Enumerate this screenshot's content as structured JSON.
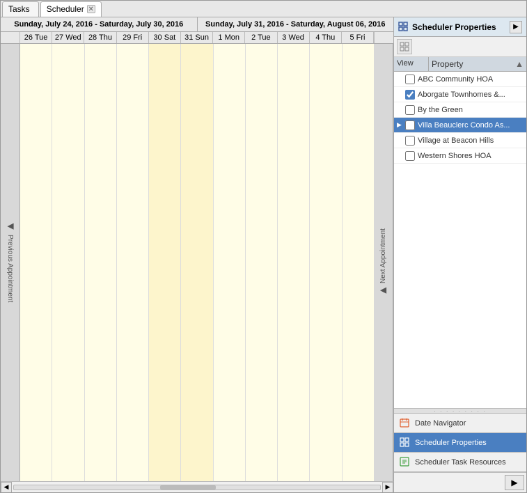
{
  "tabs": [
    {
      "id": "tasks",
      "label": "Tasks",
      "active": false,
      "closable": false
    },
    {
      "id": "scheduler",
      "label": "Scheduler",
      "active": true,
      "closable": true
    }
  ],
  "dateRanges": [
    {
      "label": "Sunday, July 24, 2016 - Saturday, July 30, 2016"
    },
    {
      "label": "Sunday, July 31, 2016 - Saturday, August 06, 2016"
    }
  ],
  "dayColumns": [
    {
      "label": "26 Tue",
      "weekend": false
    },
    {
      "label": "27 Wed",
      "weekend": false
    },
    {
      "label": "28 Thu",
      "weekend": false
    },
    {
      "label": "29 Fri",
      "weekend": false
    },
    {
      "label": "30 Sat",
      "weekend": true
    },
    {
      "label": "31 Sun",
      "weekend": true
    },
    {
      "label": "1 Mon",
      "weekend": false
    },
    {
      "label": "2 Tue",
      "weekend": false
    },
    {
      "label": "3 Wed",
      "weekend": false
    },
    {
      "label": "4 Thu",
      "weekend": false
    },
    {
      "label": "5 Fri",
      "weekend": false
    }
  ],
  "prevButton": "Previous Appointment",
  "nextButton": "Next Appointment",
  "panel": {
    "title": "Scheduler Properties",
    "viewLabel": "View",
    "propertyLabel": "Property",
    "sortArrow": "▲",
    "properties": [
      {
        "id": "abc",
        "name": "ABC Community HOA",
        "checked": false,
        "selected": false,
        "expandable": false
      },
      {
        "id": "aborgate",
        "name": "Aborgate Townhomes &...",
        "checked": true,
        "selected": false,
        "expandable": false
      },
      {
        "id": "bythegreen",
        "name": "By the Green",
        "checked": false,
        "selected": false,
        "expandable": false
      },
      {
        "id": "villa",
        "name": "Villa Beauclerc Condo As...",
        "checked": false,
        "selected": true,
        "expandable": true
      },
      {
        "id": "village",
        "name": "Village at Beacon Hills",
        "checked": false,
        "selected": false,
        "expandable": false
      },
      {
        "id": "western",
        "name": "Western Shores HOA",
        "checked": false,
        "selected": false,
        "expandable": false
      }
    ]
  },
  "bottomPanel": [
    {
      "id": "date-navigator",
      "label": "Date Navigator",
      "active": false
    },
    {
      "id": "scheduler-properties",
      "label": "Scheduler Properties",
      "active": true
    },
    {
      "id": "scheduler-task-resources",
      "label": "Scheduler Task Resources",
      "active": false
    }
  ],
  "expandButtonLabel": "▶",
  "collapseButtonLabel": "◀",
  "scrollLeftLabel": "◀",
  "scrollRightLabel": "▶",
  "scrollUpLabel": "▲",
  "scrollDownLabel": "▼",
  "bottomRightArrow": "▶"
}
